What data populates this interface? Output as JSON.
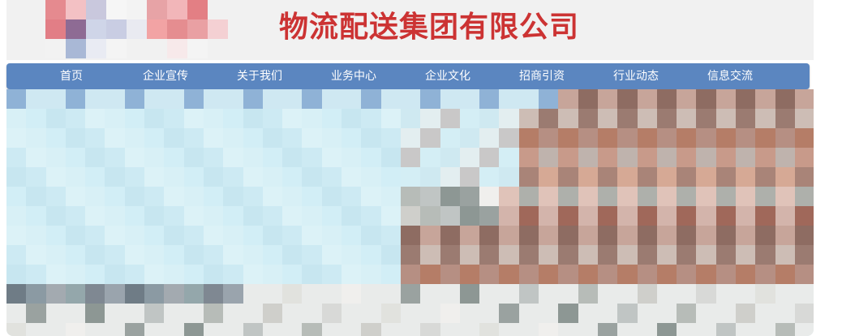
{
  "header": {
    "company_name": "物流配送集团有限公司",
    "brand_color": "#cc3333",
    "logo": "pixelated-logo"
  },
  "nav": {
    "background": "#5b86c0",
    "items": [
      {
        "label": "首页"
      },
      {
        "label": "企业宣传"
      },
      {
        "label": "关于我们"
      },
      {
        "label": "业务中心"
      },
      {
        "label": "企业文化"
      },
      {
        "label": "招商引资"
      },
      {
        "label": "行业动态"
      },
      {
        "label": "信息交流"
      }
    ]
  },
  "banner": {
    "description_icon": "pixelated-banner-image",
    "sky_color": "#d7eef4"
  }
}
